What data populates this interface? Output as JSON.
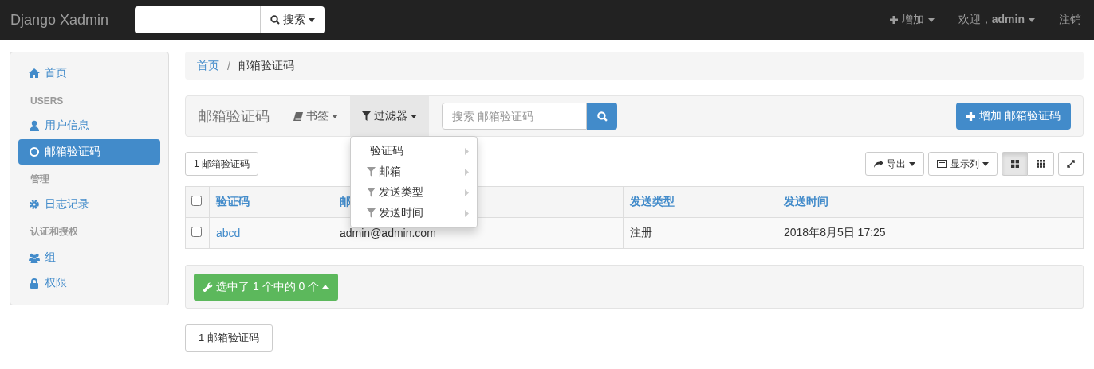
{
  "navbar": {
    "brand": "Django Xadmin",
    "search_button": "搜索",
    "add_menu": "增加",
    "welcome": "欢迎，**admin**",
    "logout": "注销"
  },
  "sidebar": {
    "items": [
      {
        "kind": "link",
        "label": "首页",
        "selected": false
      },
      {
        "kind": "header",
        "label": "USERS"
      },
      {
        "kind": "link",
        "label": "用户信息",
        "selected": false
      },
      {
        "kind": "link",
        "label": "邮箱验证码",
        "selected": true
      },
      {
        "kind": "header",
        "label": "管理"
      },
      {
        "kind": "link",
        "label": "日志记录",
        "selected": false
      },
      {
        "kind": "header",
        "label": "认证和授权"
      },
      {
        "kind": "link",
        "label": "组",
        "selected": false
      },
      {
        "kind": "link",
        "label": "权限",
        "selected": false
      }
    ]
  },
  "breadcrumb": {
    "separator": "/",
    "items": [
      "首页",
      "邮箱验证码"
    ]
  },
  "toolbar": {
    "title": "邮箱验证码",
    "bookmarks": "书签",
    "filter": {
      "label": "过滤器",
      "expanded": true
    },
    "search": {
      "placeholder": "搜索 邮箱验证码"
    },
    "add_button": "增加 邮箱验证码"
  },
  "filter_menu": [
    {
      "kind": "plain",
      "label": "验证码"
    },
    {
      "kind": "filter",
      "label": "邮箱"
    },
    {
      "kind": "filter",
      "label": "发送类型"
    },
    {
      "kind": "filter",
      "label": "发送时间"
    }
  ],
  "count_button": "1 邮箱验证码",
  "tools": {
    "export": "导出",
    "columns": "显示列",
    "views": [
      {
        "kind": "grid",
        "selected": true
      },
      {
        "kind": "dense",
        "selected": false
      }
    ]
  },
  "table": {
    "select_all_checked": false,
    "columns": [
      "验证码",
      "邮",
      "发送类型",
      "发送时间"
    ],
    "rows": [
      {
        "checked": false,
        "cells": [
          "abcd",
          "admin@admin.com",
          "注册",
          "2018年8月5日 17:25"
        ]
      }
    ]
  },
  "actions_button": "选中了 1 个中的 0 个",
  "footer_button": "1 邮箱验证码"
}
